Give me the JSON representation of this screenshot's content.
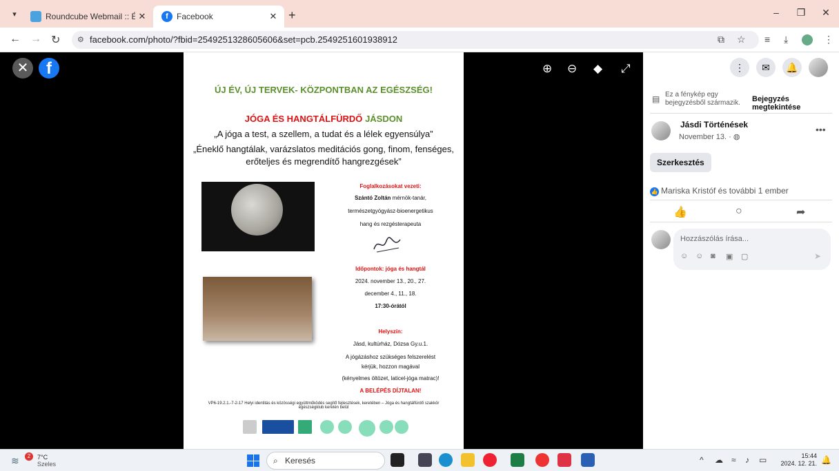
{
  "browser": {
    "tabs": [
      {
        "title": "Roundcube Webmail :: Érkezett",
        "active": false
      },
      {
        "title": "Facebook",
        "active": true
      }
    ],
    "url": "facebook.com/photo/?fbid=2549251328605606&set=pcb.2549251601938912"
  },
  "poster": {
    "title": "ÚJ ÉV, ÚJ TERVEK- KÖZPONTBAN AZ EGÉSZSÉG!",
    "subtitle_red": "JÓGA ÉS HANGTÁLFÜRDŐ",
    "subtitle_green": "JÁSDON",
    "quote1": "„A jóga a test, a szellem, a tudat és a lélek egyensúlya”",
    "quote2": "„Éneklő hangtálak, varázslatos meditációs gong, finom, fenséges, erőteljes és megrendítő hangrezgések”",
    "leader_heading": "Foglalkozásokat vezeti:",
    "leader_name": "Szántó Zoltán",
    "leader_title1": "mérnök-tanár,",
    "leader_title2": "természetgyógyász-bioenergetikus",
    "leader_title3": "hang és rezgésterapeuta",
    "dates_heading": "Időpontok: jóga és hangtál",
    "dates1": "2024. november 13., 20., 27.",
    "dates2": "december 4., 11., 18.",
    "time": "17:30-órától",
    "venue_heading": "Helyszín:",
    "venue": "Jásd, kultúrház, Dózsa Gy.u.1.",
    "equip1": "A jógázáshoz szükséges felszerelést",
    "equip2": "kérjük, hozzon magával",
    "equip3": "(kényelmes öltözet, laticel-jóga matrac)!",
    "free": "A BELÉPÉS DÍJTALAN!",
    "footer": "VP6-19.2.1.-7-2-17 Helyi identitás és közösségi együttműködés segítő fejlesztések, keretében – Jóga és hangtálfürdő szakkör egészségklub keretén belül"
  },
  "panel": {
    "info_text": "Ez a fénykép egy bejegyzésből származik.",
    "info_link": "Bejegyzés megtekintése",
    "author": "Jásdi Történések",
    "date": "November 13. ·",
    "edit_label": "Szerkesztés",
    "reactions": "Mariska Kristóf és további 1 ember",
    "comment_placeholder": "Hozzászólás írása..."
  },
  "taskbar": {
    "weather_temp": "7°C",
    "weather_cond": "Szeles",
    "weather_badge": "2",
    "search_label": "Keresés",
    "time": "15:44",
    "date": "2024. 12. 21."
  }
}
